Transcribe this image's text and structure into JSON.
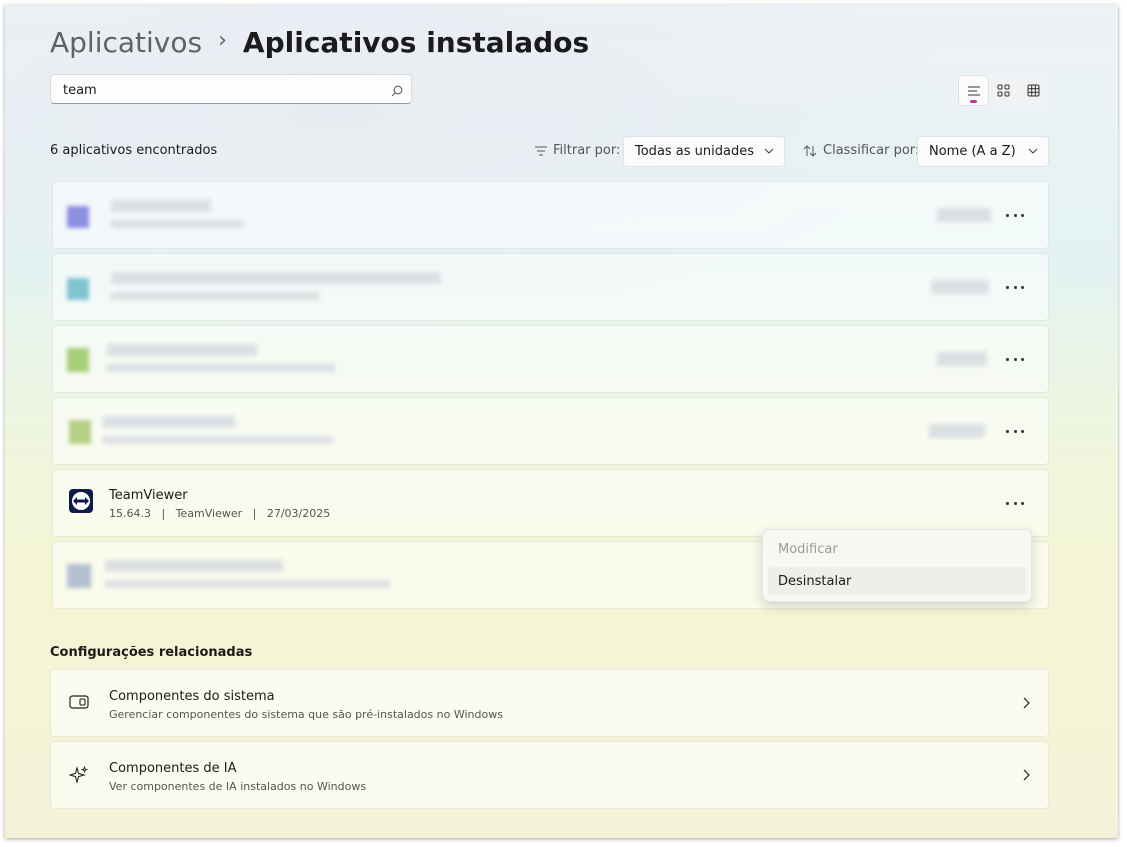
{
  "breadcrumb": {
    "parent": "Aplicativos",
    "separator": "›",
    "current": "Aplicativos instalados"
  },
  "search": {
    "value": "team",
    "placeholder": ""
  },
  "results": {
    "count_text": "6 aplicativos encontrados",
    "filter_label": "Filtrar por:",
    "filter_value": "Todas as unidades",
    "sort_label": "Classificar por:",
    "sort_value": "Nome (A a Z)"
  },
  "apps": [
    {
      "name": "",
      "blurred": true
    },
    {
      "name": "",
      "blurred": true
    },
    {
      "name": "",
      "blurred": true
    },
    {
      "name": "",
      "blurred": true
    },
    {
      "name": "TeamViewer",
      "version": "15.64.3",
      "publisher": "TeamViewer",
      "date": "27/03/2025",
      "blurred": false
    },
    {
      "name": "",
      "blurred": true
    }
  ],
  "context_menu": {
    "items": [
      {
        "label": "Modificar",
        "enabled": false
      },
      {
        "label": "Desinstalar",
        "enabled": true
      }
    ]
  },
  "related": {
    "title": "Configurações relacionadas",
    "items": [
      {
        "title": "Componentes do sistema",
        "subtitle": "Gerenciar componentes do sistema que são pré-instalados no Windows",
        "icon": "system-components-icon"
      },
      {
        "title": "Componentes de IA",
        "subtitle": "Ver componentes de IA instalados no Windows",
        "icon": "sparkle-icon"
      }
    ]
  },
  "colors": {
    "accent_indicator": "#c3389f",
    "teamviewer_blue": "#0e1a4a"
  }
}
